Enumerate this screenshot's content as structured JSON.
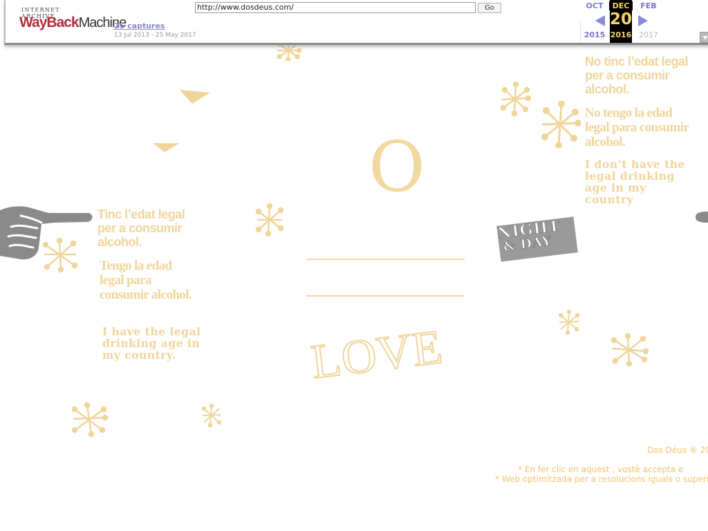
{
  "wayback": {
    "logo_top": "INTERNET ARCHIVE",
    "logo_way": "WayBack",
    "logo_machine": "Machine",
    "url_value": "http://www.dosdeus.com/",
    "go_label": "Go",
    "captures": "25 captures",
    "date_range": "13 Jul 2013 - 25 May 2017",
    "months": {
      "prev": "OCT",
      "current": "DEC",
      "next": "FEB"
    },
    "day": "20",
    "years": {
      "prev": "2015",
      "current": "2016",
      "next": "2017"
    }
  },
  "page": {
    "left_messages": {
      "catalan": "Tinc l’edat legal per a consumir alcohol.",
      "spanish": "Tengo la edad legal para consumir alcohol.",
      "english": "I have the legal drinking age in my country."
    },
    "right_messages": {
      "catalan": "No tinc l’edat legal per a consumir alcohol.",
      "spanish": "No tengo la edad legal para consumir alcohol.",
      "english": "I don’t have the legal drinking age in my country"
    },
    "center_letter": "O",
    "love_word": "LOVE",
    "night_day": {
      "line1": "NIGHT",
      "line2": "& DAY"
    },
    "footer": {
      "copyright": "Dos Déus ® 20",
      "terms": "* En fer clic en aquest            , vostè accepta e",
      "resolution": "* Web optimitzada per a resolucions iguals o superi"
    }
  },
  "colors": {
    "gold": "#f0d59a",
    "footer_gold": "#f0c36a",
    "grey_hand": "#8a8a8a",
    "wayback_blue": "#7777cc"
  }
}
